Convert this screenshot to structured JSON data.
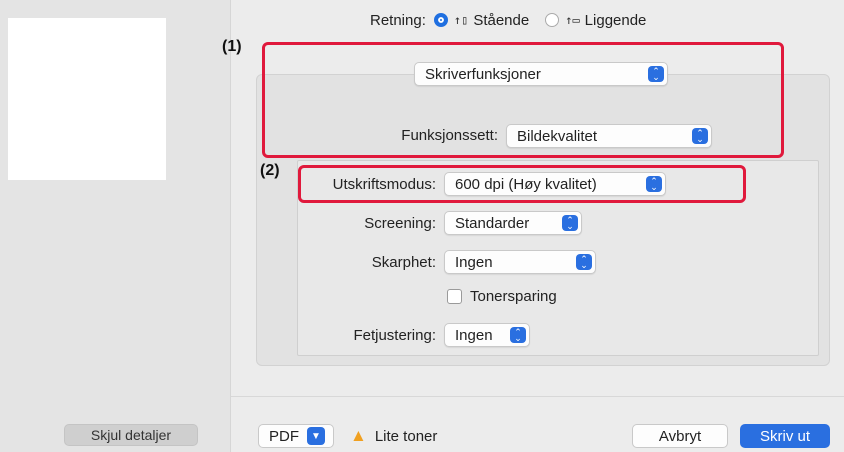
{
  "orientation": {
    "label": "Retning:",
    "options": [
      {
        "label": "Stående",
        "selected": true,
        "icon": "portrait-icon"
      },
      {
        "label": "Liggende",
        "selected": false,
        "icon": "landscape-icon"
      }
    ]
  },
  "callouts": {
    "one": "(1)",
    "two": "(2)"
  },
  "section_popup": {
    "value": "Skriverfunksjoner"
  },
  "feature_set": {
    "label": "Funksjonssett:",
    "value": "Bildekvalitet"
  },
  "settings": {
    "print_mode": {
      "label": "Utskriftsmodus:",
      "value": "600 dpi (Høy kvalitet)"
    },
    "screening": {
      "label": "Screening:",
      "value": "Standarder"
    },
    "sharpness": {
      "label": "Skarphet:",
      "value": "Ingen"
    },
    "toner_save": {
      "label": "Tonersparing",
      "checked": false
    },
    "smoothing": {
      "label": "Fetjustering:",
      "value": "Ingen"
    }
  },
  "sidebar": {
    "hide_details": "Skjul detaljer"
  },
  "footer": {
    "pdf": "PDF",
    "warning": "Lite toner",
    "cancel": "Avbryt",
    "print": "Skriv ut"
  },
  "colors": {
    "accent": "#2a6fe0",
    "annotation": "#e0193c",
    "warning": "#f0a020"
  }
}
